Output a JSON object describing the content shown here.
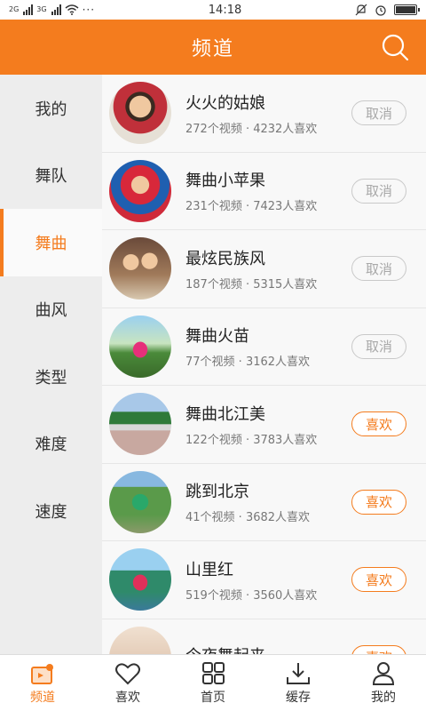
{
  "status_bar": {
    "left_network_1": "2G",
    "left_network_2": "3G",
    "extra": "···",
    "time": "14:18",
    "battery_level": 1.0
  },
  "header": {
    "title": "频道",
    "search_icon": "search-icon"
  },
  "sidebar": {
    "items": [
      {
        "label": "我的",
        "active": false
      },
      {
        "label": "舞队",
        "active": false
      },
      {
        "label": "舞曲",
        "active": true
      },
      {
        "label": "曲风",
        "active": false
      },
      {
        "label": "类型",
        "active": false
      },
      {
        "label": "难度",
        "active": false
      },
      {
        "label": "速度",
        "active": false
      }
    ]
  },
  "channels": [
    {
      "name": "火火的姑娘",
      "meta": "272个视频 · 4232人喜欢",
      "button": "取消",
      "state": "cancel"
    },
    {
      "name": "舞曲小苹果",
      "meta": "231个视频 · 7423人喜欢",
      "button": "取消",
      "state": "cancel"
    },
    {
      "name": "最炫民族风",
      "meta": "187个视频 · 5315人喜欢",
      "button": "取消",
      "state": "cancel"
    },
    {
      "name": "舞曲火苗",
      "meta": "77个视频 · 3162人喜欢",
      "button": "取消",
      "state": "cancel"
    },
    {
      "name": "舞曲北江美",
      "meta": "122个视频 · 3783人喜欢",
      "button": "喜欢",
      "state": "like"
    },
    {
      "name": "跳到北京",
      "meta": "41个视频 · 3682人喜欢",
      "button": "喜欢",
      "state": "like"
    },
    {
      "name": "山里红",
      "meta": "519个视频 · 3560人喜欢",
      "button": "喜欢",
      "state": "like"
    },
    {
      "name": "今夜舞起来",
      "meta": "",
      "button": "喜欢",
      "state": "like"
    }
  ],
  "tabbar": {
    "items": [
      {
        "label": "频道",
        "icon": "channel-icon",
        "active": true
      },
      {
        "label": "喜欢",
        "icon": "heart-icon",
        "active": false
      },
      {
        "label": "首页",
        "icon": "grid-icon",
        "active": false
      },
      {
        "label": "缓存",
        "icon": "download-icon",
        "active": false
      },
      {
        "label": "我的",
        "icon": "user-icon",
        "active": false
      }
    ]
  },
  "colors": {
    "accent": "#f47c1e",
    "header_bg": "#f47c1e",
    "sidebar_bg": "#ededed"
  }
}
